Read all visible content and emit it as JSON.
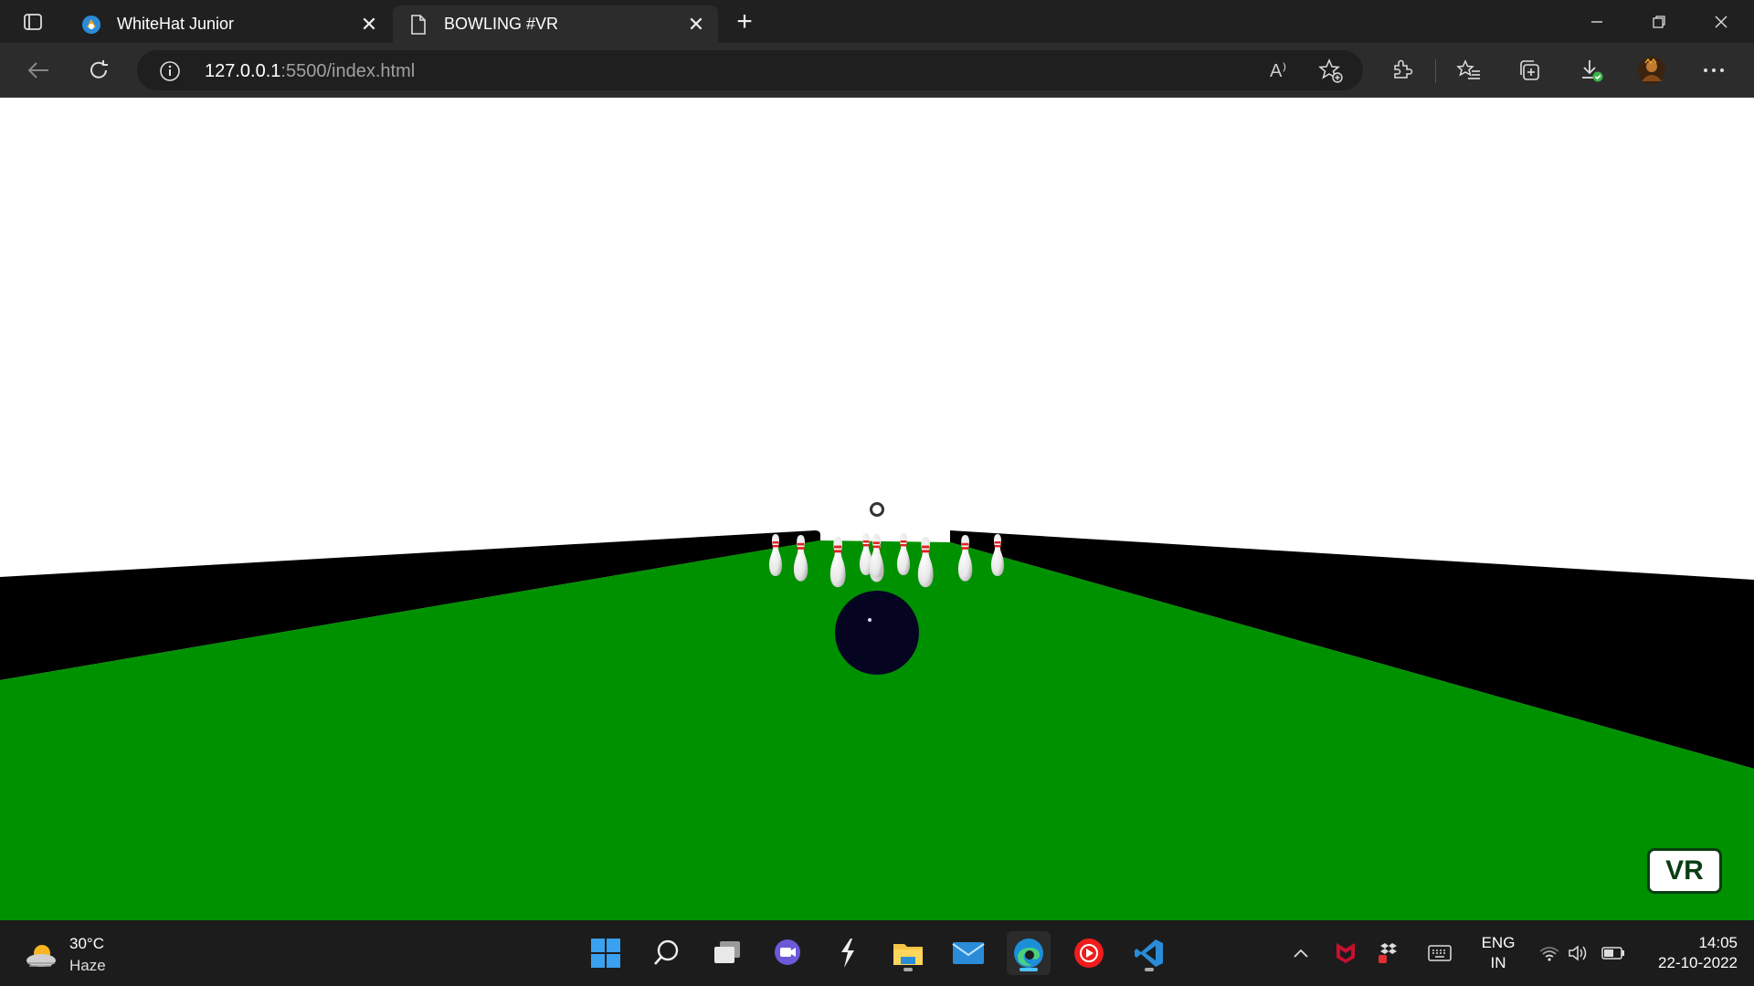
{
  "browser": {
    "tabs": [
      {
        "title": "WhiteHat Junior",
        "active": false,
        "favicon": "whitehat-logo-icon"
      },
      {
        "title": "BOWLING #VR",
        "active": true,
        "favicon": "page-icon"
      }
    ],
    "address": {
      "host": "127.0.0.1",
      "path": ":5500/index.html"
    },
    "read_aloud_label": "A⁾"
  },
  "scene": {
    "vr_button_label": "VR",
    "colors": {
      "lane": "#009100",
      "gutter": "#000000",
      "sky": "#ffffff",
      "ball": "#050522",
      "pin_stripe": "#e02020"
    },
    "pin_count": 10
  },
  "taskbar": {
    "weather": {
      "temp": "30°C",
      "condition": "Haze"
    },
    "language": {
      "line1": "ENG",
      "line2": "IN"
    },
    "clock": {
      "time": "14:05",
      "date": "22-10-2022"
    }
  }
}
